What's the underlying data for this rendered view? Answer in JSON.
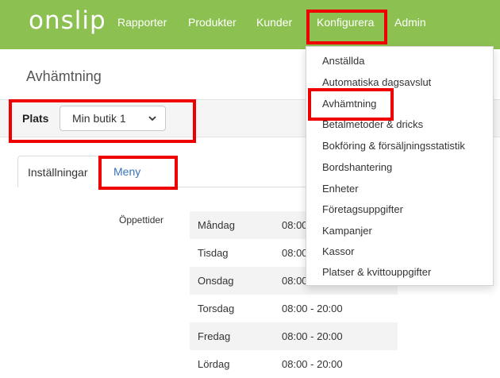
{
  "header": {
    "logo": "onslip",
    "nav": [
      {
        "label": "Rapporter"
      },
      {
        "label": "Produkter"
      },
      {
        "label": "Kunder"
      },
      {
        "label": "Konfigurera"
      },
      {
        "label": "Admin"
      }
    ]
  },
  "dropdown": {
    "items": [
      {
        "label": "Anställda"
      },
      {
        "label": "Automatiska dagsavslut"
      },
      {
        "label": "Avhämtning"
      },
      {
        "label": "Betalmetoder & dricks"
      },
      {
        "label": "Bokföring & försäljningsstatistik"
      },
      {
        "label": "Bordshantering"
      },
      {
        "label": "Enheter"
      },
      {
        "label": "Företagsuppgifter"
      },
      {
        "label": "Kampanjer"
      },
      {
        "label": "Kassor"
      },
      {
        "label": "Platser & kvittouppgifter"
      }
    ]
  },
  "page": {
    "title": "Avhämtning"
  },
  "filter": {
    "label": "Plats",
    "selected": "Min butik 1"
  },
  "tabs": [
    {
      "label": "Inställningar"
    },
    {
      "label": "Meny"
    }
  ],
  "hours": {
    "label": "Öppettider",
    "rows": [
      {
        "day": "Måndag",
        "time": "08:00"
      },
      {
        "day": "Tisdag",
        "time": "08:00"
      },
      {
        "day": "Onsdag",
        "time": "08:00"
      },
      {
        "day": "Torsdag",
        "time": "08:00 - 20:00"
      },
      {
        "day": "Fredag",
        "time": "08:00 - 20:00"
      },
      {
        "day": "Lördag",
        "time": "08:00 - 20:00"
      }
    ]
  },
  "colors": {
    "brand_green": "#8cc152",
    "highlight_red": "#ee0000",
    "link_blue": "#3b73b9"
  }
}
